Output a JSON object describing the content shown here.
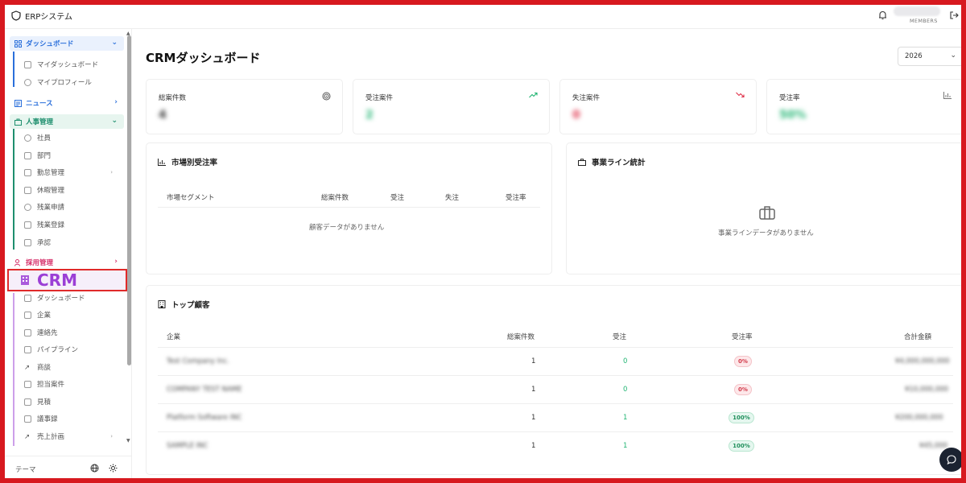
{
  "app": {
    "title": "ERPシステム"
  },
  "topbar": {
    "members_label": "MEMBERS"
  },
  "sidebar": {
    "sections": [
      {
        "label": "ダッシュボード",
        "expanded": true,
        "items": [
          {
            "label": "マイダッシュボード"
          },
          {
            "label": "マイプロフィール"
          }
        ]
      },
      {
        "label": "ニュース",
        "expanded": false,
        "items": []
      },
      {
        "label": "人事管理",
        "expanded": true,
        "items": [
          {
            "label": "社員"
          },
          {
            "label": "部門"
          },
          {
            "label": "勤怠管理"
          },
          {
            "label": "休暇管理"
          },
          {
            "label": "残業申請"
          },
          {
            "label": "残業登録"
          },
          {
            "label": "承認"
          }
        ]
      },
      {
        "label": "採用管理",
        "expanded": false,
        "items": []
      },
      {
        "label": "CRM",
        "expanded": true,
        "items": [
          {
            "label": "ダッシュボード"
          },
          {
            "label": "企業"
          },
          {
            "label": "連絡先"
          },
          {
            "label": "パイプライン"
          },
          {
            "label": "商談"
          },
          {
            "label": "担当案件"
          },
          {
            "label": "見積"
          },
          {
            "label": "議事録"
          },
          {
            "label": "売上計画"
          }
        ]
      }
    ],
    "footer": {
      "theme_label": "テーマ"
    }
  },
  "main": {
    "page_title": "CRMダッシュボード",
    "year_select": {
      "value": "2026"
    },
    "stats": [
      {
        "label": "総案件数",
        "value": "4",
        "color": "#333333",
        "icon": "target-icon"
      },
      {
        "label": "受注案件",
        "value": "2",
        "color": "#22b573",
        "icon": "trending-up-icon"
      },
      {
        "label": "失注案件",
        "value": "0",
        "color": "#e0344c",
        "icon": "trending-down-icon"
      },
      {
        "label": "受注率",
        "value": "50%",
        "color": "#22b573",
        "icon": "bar-chart-icon"
      }
    ],
    "market_panel": {
      "title": "市場別受注率",
      "columns": [
        "市場セグメント",
        "総案件数",
        "受注",
        "失注",
        "受注率"
      ],
      "empty_text": "顧客データがありません"
    },
    "business_panel": {
      "title": "事業ライン統計",
      "empty_text": "事業ラインデータがありません"
    },
    "top_customers": {
      "title": "トップ顧客",
      "columns": [
        "企業",
        "総案件数",
        "受注",
        "受注率",
        "合計金額"
      ],
      "rows": [
        {
          "company": "Test Company Inc.",
          "total": "1",
          "won": "0",
          "rate": "0%",
          "amount": "¥4,000,000,000"
        },
        {
          "company": "COMPANY TEST NAME",
          "total": "1",
          "won": "0",
          "rate": "0%",
          "amount": "¥10,000,000"
        },
        {
          "company": "Platform Software INC",
          "total": "1",
          "won": "1",
          "rate": "100%",
          "amount": "¥200,000,000"
        },
        {
          "company": "SAMPLE INC",
          "total": "1",
          "won": "1",
          "rate": "100%",
          "amount": "¥45,000"
        }
      ]
    }
  }
}
